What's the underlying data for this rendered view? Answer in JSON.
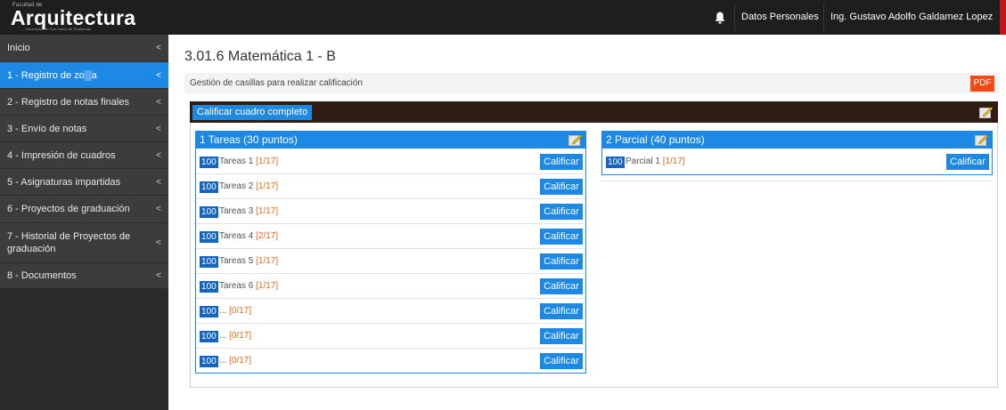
{
  "brand": {
    "small_text": "Facultad de",
    "name": "Arquitectura",
    "sub_text": "Universidad de San Carlos de Guatemala"
  },
  "topbar": {
    "notifications_icon": "bell-icon",
    "datos_personales": "Datos Personales",
    "user_name": "Ing. Gustavo Adolfo Galdamez Lopez",
    "accent_color": "#c0151a"
  },
  "sidebar": {
    "chevron": "<",
    "items": [
      {
        "label": "Inicio",
        "active": false
      },
      {
        "label": "1 - Registro de zo▒a",
        "active": true
      },
      {
        "label": "2 - Registro de notas finales",
        "active": false
      },
      {
        "label": "3 - Envío de notas",
        "active": false
      },
      {
        "label": "4 - Impresión de cuadros",
        "active": false
      },
      {
        "label": "5 - Asignaturas impartidas",
        "active": false
      },
      {
        "label": "6 - Proyectos de graduación",
        "active": false
      },
      {
        "label": "7 - Historial de Proyectos de graduación",
        "active": false
      },
      {
        "label": "8 - Documentos",
        "active": false
      }
    ],
    "active_color": "#1e88e5"
  },
  "main": {
    "title": "3.01.6 Matemática 1 - B",
    "subheader": "Gestión de casillas para realizar calificación",
    "pdf_label": "PDF",
    "pdf_color": "#f44a16",
    "calificar_completo": "Calificar cuadro completo",
    "edit_icon": "edit-icon"
  },
  "cards": [
    {
      "title": "1 Tareas (30 puntos)",
      "rows": [
        {
          "badge": "100",
          "label": "Tareas 1",
          "count": "[1/17]",
          "button": "Calificar"
        },
        {
          "badge": "100",
          "label": "Tareas 2",
          "count": "[1/17]",
          "button": "Calificar"
        },
        {
          "badge": "100",
          "label": "Tareas 3",
          "count": "[1/17]",
          "button": "Calificar"
        },
        {
          "badge": "100",
          "label": "Tareas 4",
          "count": "[2/17]",
          "button": "Calificar"
        },
        {
          "badge": "100",
          "label": "Tareas 5",
          "count": "[1/17]",
          "button": "Calificar"
        },
        {
          "badge": "100",
          "label": "Tareas 6",
          "count": "[1/17]",
          "button": "Calificar"
        },
        {
          "badge": "100",
          "label": "...",
          "count": "[0/17]",
          "button": "Calificar"
        },
        {
          "badge": "100",
          "label": "...",
          "count": "[0/17]",
          "button": "Calificar"
        },
        {
          "badge": "100",
          "label": "...",
          "count": "[0/17]",
          "button": "Calificar"
        }
      ]
    },
    {
      "title": "2 Parcial (40 puntos)",
      "rows": [
        {
          "badge": "100",
          "label": "Parcial 1",
          "count": "[1/17]",
          "button": "Calificar"
        }
      ]
    }
  ]
}
